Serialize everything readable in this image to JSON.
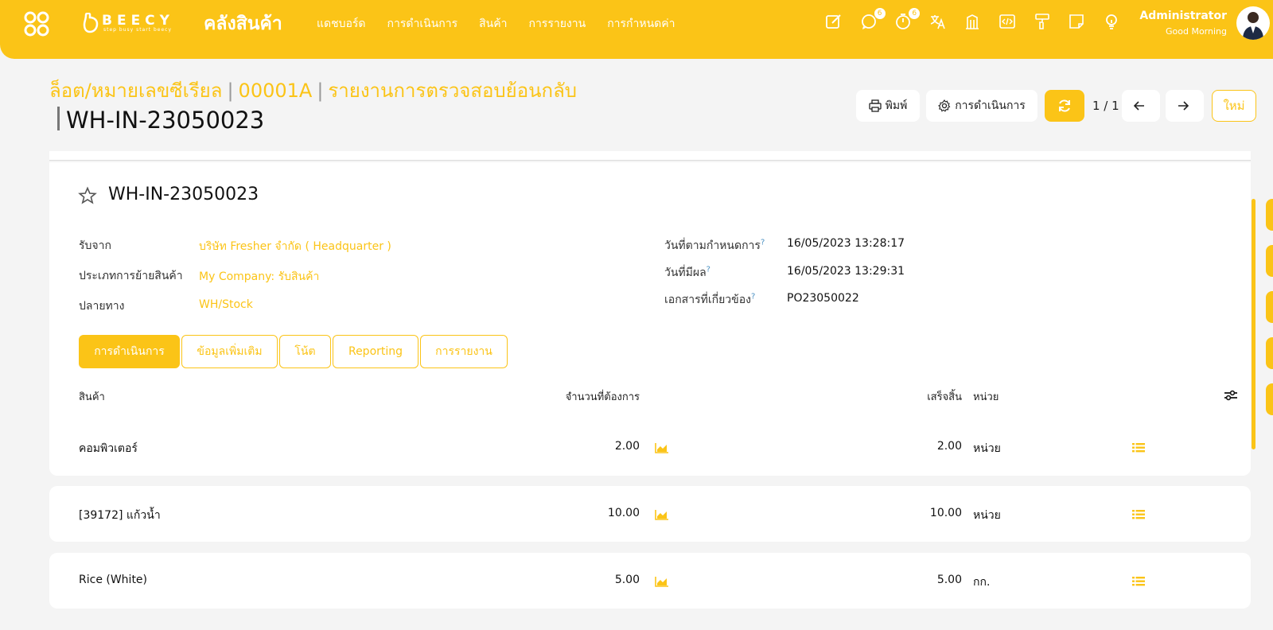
{
  "topbar": {
    "brand_name": "BEECY",
    "brand_tagline": "step busy start beecy",
    "module_title": "คลังสินค้า",
    "menu": [
      "แดชบอร์ด",
      "การดำเนินการ",
      "สินค้า",
      "การรายงาน",
      "การกำหนดค่า"
    ],
    "tool_icons": [
      "edit-icon",
      "chat-icon",
      "timer-icon",
      "translate-icon",
      "building-icon",
      "code-icon",
      "paint-roller-icon",
      "note-icon",
      "lightbulb-icon"
    ],
    "chat_badge": "6",
    "timer_badge": "6",
    "user_name": "Administrator",
    "greeting": "Good Morning"
  },
  "breadcrumb": {
    "items": [
      "ล็อต/หมายเลขซีเรียล",
      "00001A",
      "รายงานการตรวจสอบย้อนกลับ"
    ],
    "separator": "|",
    "current": "WH-IN-23050023"
  },
  "controls": {
    "print_label": "พิมพ์",
    "action_label": "การดำเนินการ",
    "pager": "1 / 1",
    "new_label": "ใหม่"
  },
  "form": {
    "title": "WH-IN-23050023",
    "left_fields": [
      {
        "label": "รับจาก",
        "value": "บริษัท Fresher จำกัด ( Headquarter )"
      },
      {
        "label": "ประเภทการย้ายสินค้า",
        "value": "My Company: รับสินค้า"
      },
      {
        "label": "ปลายทาง",
        "value": "WH/Stock"
      }
    ],
    "right_fields": [
      {
        "label": "วันที่ตามกำหนดการ",
        "help": "?",
        "value": "16/05/2023 13:28:17"
      },
      {
        "label": "วันที่มีผล",
        "help": "?",
        "value": "16/05/2023 13:29:31"
      },
      {
        "label": "เอกสารที่เกี่ยวข้อง",
        "help": "?",
        "value": "PO23050022"
      }
    ],
    "tabs": [
      "การดำเนินการ",
      "ข้อมูลเพิ่มเติม",
      "โน้ต",
      "Reporting",
      "การรายงาน"
    ]
  },
  "table": {
    "headers": {
      "product": "สินค้า",
      "demand": "จำนวนที่ต้องการ",
      "done": "เสร็จสิ้น",
      "uom": "หน่วย"
    },
    "rows": [
      {
        "product": "คอมพิวเตอร์",
        "demand": "2.00",
        "done": "2.00",
        "uom": "หน่วย"
      },
      {
        "product": "[39172] แก้วน้ำ",
        "demand": "10.00",
        "done": "10.00",
        "uom": "หน่วย"
      },
      {
        "product": "Rice (White)",
        "demand": "5.00",
        "done": "5.00",
        "uom": "กก."
      }
    ]
  },
  "colors": {
    "accent": "#fbc417",
    "help": "#4a90c2"
  }
}
